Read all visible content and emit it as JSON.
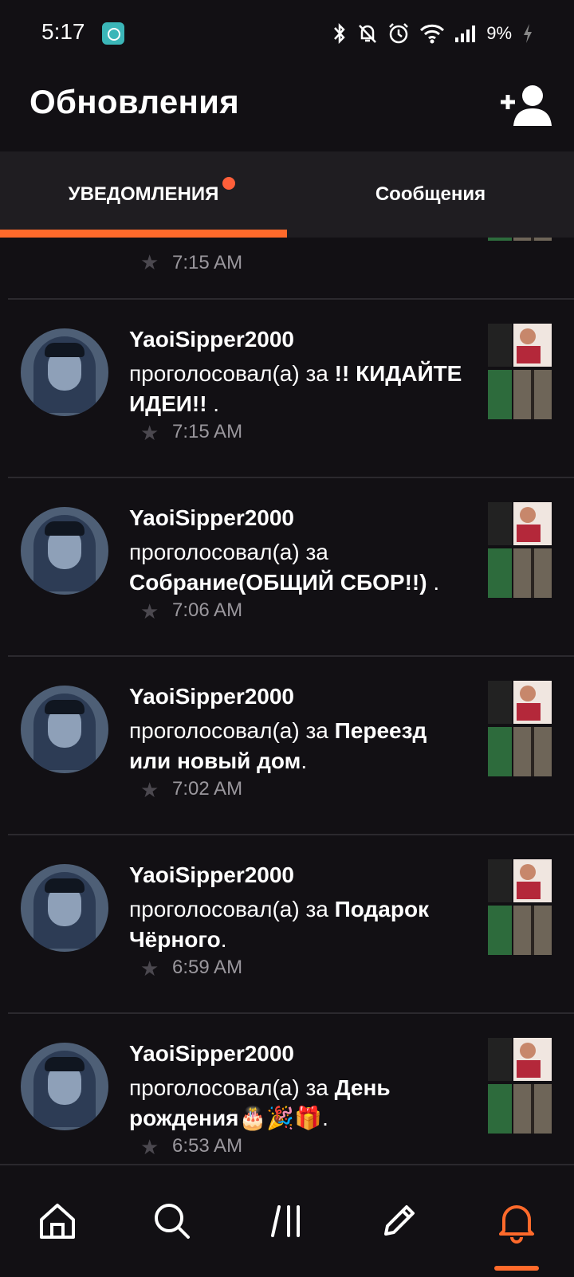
{
  "status_bar": {
    "time": "5:17",
    "battery": "9%",
    "icons": [
      "app-notification-icon",
      "bluetooth-icon",
      "mute-icon",
      "alarm-icon",
      "wifi-icon",
      "signal-icon",
      "battery-icon"
    ]
  },
  "header": {
    "title": "Обновления",
    "add_user_icon": "add-user-icon"
  },
  "tabs": [
    {
      "label": "УВЕДОМЛЕНИЯ",
      "active": true,
      "has_badge": true
    },
    {
      "label": "Сообщения",
      "active": false
    }
  ],
  "partial_item": {
    "time": "7:15 AM"
  },
  "notifications": [
    {
      "user": "YaoiSipper2000",
      "action": "проголосовал(а) за",
      "target": "!! КИДАЙТЕ ИДЕИ!!",
      "suffix": " .",
      "time": "7:15 AM"
    },
    {
      "user": "YaoiSipper2000",
      "action": "проголосовал(а) за",
      "target": "Собрание(ОБЩИЙ СБОР!!)",
      "suffix": " .",
      "time": "7:06 AM"
    },
    {
      "user": "YaoiSipper2000",
      "action": "проголосовал(а) за",
      "target": "Переезд или новый дом",
      "suffix": ".",
      "time": "7:02 AM"
    },
    {
      "user": "YaoiSipper2000",
      "action": "проголосовал(а) за",
      "target": "Подарок Чёрного",
      "suffix": ".",
      "time": "6:59 AM"
    },
    {
      "user": "YaoiSipper2000",
      "action": "проголосовал(а) за",
      "target": "День рождения🎂🎉🎁",
      "suffix": ".",
      "time": "6:53 AM"
    }
  ],
  "bottom_nav": [
    {
      "icon": "home-icon",
      "active": false
    },
    {
      "icon": "search-icon",
      "active": false
    },
    {
      "icon": "library-icon",
      "active": false
    },
    {
      "icon": "write-icon",
      "active": false
    },
    {
      "icon": "bell-icon",
      "active": true
    }
  ],
  "colors": {
    "accent": "#ff6a2b",
    "background": "#121014",
    "tab_bar": "#1f1d21",
    "muted_text": "#9a979d"
  }
}
